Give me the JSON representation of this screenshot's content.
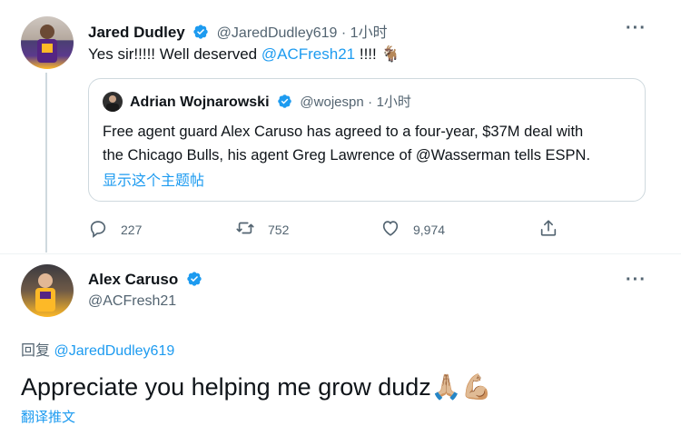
{
  "tweet1": {
    "author_name": "Jared Dudley",
    "author_handle": "@JaredDudley619",
    "separator": "·",
    "time": "1小时",
    "text_prefix": "Yes sir!!!!! Well deserved ",
    "mention": "@ACFresh21",
    "text_suffix": " !!!! ",
    "emoji": "🐐",
    "quote": {
      "author_name": "Adrian Wojnarowski",
      "author_handle": "@wojespn",
      "separator": "·",
      "time": "1小时",
      "line1": "Free agent guard Alex Caruso has agreed to a four-year, $37M deal with",
      "line2": "the Chicago Bulls, his agent Greg Lawrence of @Wasserman tells ESPN.",
      "show_thread": "显示这个主题帖"
    },
    "actions": {
      "reply_count": "227",
      "retweet_count": "752",
      "like_count": "9,974"
    }
  },
  "tweet2": {
    "author_name": "Alex Caruso",
    "author_handle": "@ACFresh21",
    "reply_label": "回复",
    "reply_to": "@JaredDudley619",
    "text": "Appreciate you helping me grow dudz",
    "emojis": "🙏🏼💪🏼",
    "translate_label": "翻译推文"
  },
  "icons": {
    "verified": "verified-badge-icon",
    "more": "more-options-icon",
    "reply": "reply-icon",
    "retweet": "retweet-icon",
    "like": "heart-icon",
    "share": "share-icon"
  },
  "colors": {
    "accent": "#1d9bf0",
    "secondary_text": "#536471",
    "border": "#cfd9de"
  }
}
